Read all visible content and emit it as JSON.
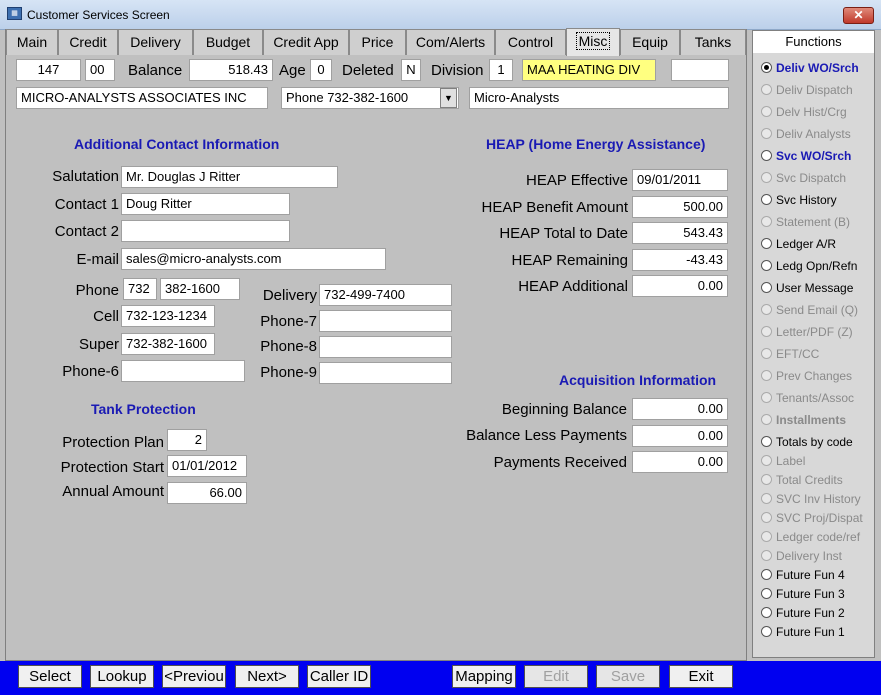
{
  "window": {
    "title": "Customer Services Screen",
    "close": "✕"
  },
  "tabs": [
    "Main",
    "Credit",
    "Delivery",
    "Budget",
    "Credit App",
    "Price",
    "Com/Alerts",
    "Control",
    "Misc",
    "Equip",
    "Tanks"
  ],
  "header": {
    "account": "147",
    "sub": "00",
    "balance_label": "Balance",
    "balance": "518.43",
    "age_label": "Age",
    "age": "0",
    "deleted_label": "Deleted",
    "deleted": "N",
    "division_label": "Division",
    "division": "1",
    "division_name": "MAA HEATING  DIV",
    "extra": "",
    "customer_name": "MICRO-ANALYSTS ASSOCIATES INC",
    "phone_select": "Phone 732-382-1600",
    "short_name": "Micro-Analysts"
  },
  "contact": {
    "title": "Additional Contact Information",
    "salutation_label": "Salutation",
    "salutation": "Mr. Douglas J Ritter",
    "contact1_label": "Contact 1",
    "contact1": "Doug Ritter",
    "contact2_label": "Contact 2",
    "contact2": "",
    "email_label": "E-mail",
    "email": "sales@micro-analysts.com",
    "phone_label": "Phone",
    "phone_area": "732",
    "phone_num": "382-1600",
    "cell_label": "Cell",
    "cell": "732-123-1234",
    "super_label": "Super",
    "super": "732-382-1600",
    "phone6_label": "Phone-6",
    "phone6": "",
    "delivery_label": "Delivery",
    "delivery": "732-499-7400",
    "phone7_label": "Phone-7",
    "phone7": "",
    "phone8_label": "Phone-8",
    "phone8": "",
    "phone9_label": "Phone-9",
    "phone9": ""
  },
  "tank": {
    "title": "Tank Protection",
    "plan_label": "Protection Plan",
    "plan": "2",
    "start_label": "Protection Start",
    "start": "01/01/2012",
    "annual_label": "Annual Amount",
    "annual": "66.00"
  },
  "heap": {
    "title": "HEAP (Home Energy Assistance)",
    "effective_label": "HEAP Effective",
    "effective": "09/01/2011",
    "benefit_label": "HEAP Benefit Amount",
    "benefit": "500.00",
    "total_label": "HEAP Total to Date",
    "total": "543.43",
    "remaining_label": "HEAP Remaining",
    "remaining": "-43.43",
    "additional_label": "HEAP Additional",
    "additional": "0.00"
  },
  "acquisition": {
    "title": "Acquisition Information",
    "beginning_label": "Beginning Balance",
    "beginning": "0.00",
    "less_label": "Balance Less Payments",
    "less": "0.00",
    "received_label": "Payments Received",
    "received": "0.00"
  },
  "functions": {
    "title": "Functions",
    "items": [
      {
        "label": "Deliv WO/Srch",
        "state": "selected"
      },
      {
        "label": "Deliv Dispatch",
        "state": "disabled"
      },
      {
        "label": "Delv Hist/Crg",
        "state": "disabled"
      },
      {
        "label": "Deliv Analysts",
        "state": "disabled"
      },
      {
        "label": "Svc WO/Srch",
        "state": "blue"
      },
      {
        "label": "Svc Dispatch",
        "state": "disabled"
      },
      {
        "label": "Svc History",
        "state": "normal"
      },
      {
        "label": "Statement (B)",
        "state": "disabled"
      },
      {
        "label": "Ledger A/R",
        "state": "normal"
      },
      {
        "label": "Ledg Opn/Refn",
        "state": "normal"
      },
      {
        "label": "User Message",
        "state": "normal"
      },
      {
        "label": "Send Email (Q)",
        "state": "disabled"
      },
      {
        "label": "Letter/PDF (Z)",
        "state": "disabled"
      },
      {
        "label": "EFT/CC",
        "state": "disabled"
      },
      {
        "label": "Prev Changes",
        "state": "disabled"
      },
      {
        "label": "Tenants/Assoc",
        "state": "disabled"
      },
      {
        "label": "Installments",
        "state": "bold-disabled"
      },
      {
        "label": "Totals by code",
        "state": "normal"
      },
      {
        "label": "Label",
        "state": "disabled"
      },
      {
        "label": "Total Credits",
        "state": "disabled"
      },
      {
        "label": "SVC Inv History",
        "state": "disabled"
      },
      {
        "label": "SVC Proj/Dispat",
        "state": "disabled"
      },
      {
        "label": "Ledger code/ref",
        "state": "disabled"
      },
      {
        "label": "Delivery Inst",
        "state": "disabled"
      },
      {
        "label": "Future Fun 4",
        "state": "normal"
      },
      {
        "label": "Future Fun 3",
        "state": "normal"
      },
      {
        "label": "Future Fun 2",
        "state": "normal"
      },
      {
        "label": "Future Fun 1",
        "state": "normal"
      }
    ]
  },
  "buttons": {
    "select": "Select",
    "lookup": "Lookup",
    "previous": "<Previou",
    "next": "Next>",
    "caller_id": "Caller ID",
    "mapping": "Mapping",
    "edit": "Edit",
    "save": "Save",
    "exit": "Exit"
  }
}
